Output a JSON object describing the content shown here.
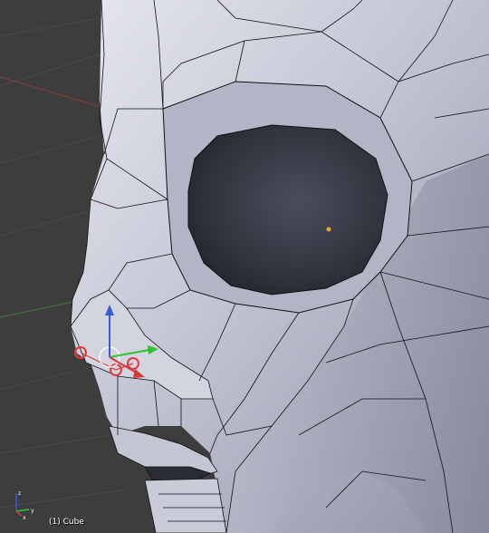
{
  "viewport": {
    "object_label": "(1) Cube",
    "background_color": "#3d3d3d",
    "mesh_color": "#c9cbd8",
    "wire_color": "#111111",
    "selected_color": "#e23b3b",
    "origin_color": "#f0a030",
    "grid_x_axis_color": "#8a3a3a",
    "grid_y_axis_color": "#3e7a3e"
  },
  "gizmo": {
    "axes": [
      "x",
      "y",
      "z"
    ],
    "icon": "3d-axis-gizmo-icon"
  },
  "manipulator": {
    "icon": "transform-manipulator-icon",
    "x_color": "#d43a3a",
    "y_color": "#2ec42e",
    "z_color": "#3a5ad4"
  }
}
